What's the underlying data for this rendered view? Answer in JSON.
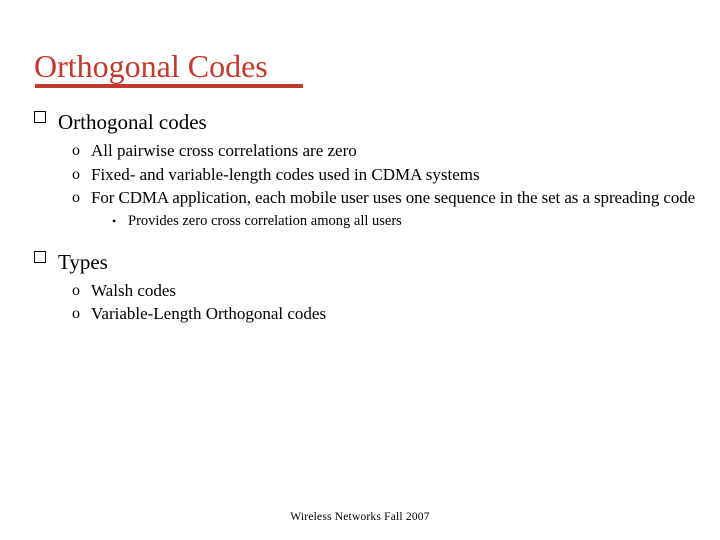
{
  "slide": {
    "title": "Orthogonal Codes",
    "title_color": "#C13A2E",
    "background_color": "#FFFFFF",
    "text_color": "#000000",
    "footer": "Wireless Networks Fall 2007",
    "bullet_markers": {
      "level1": "box-bullet",
      "level2": "o",
      "level3": "•"
    },
    "sections": [
      {
        "heading": "Orthogonal codes",
        "items": [
          {
            "level": 2,
            "text": "All pairwise cross correlations are zero"
          },
          {
            "level": 2,
            "text": "Fixed- and variable-length codes used in CDMA systems"
          },
          {
            "level": 2,
            "text": "For CDMA application, each mobile user uses one sequence in the set as a spreading code"
          },
          {
            "level": 3,
            "text": "Provides zero cross correlation among all users"
          }
        ]
      },
      {
        "heading": "Types",
        "items": [
          {
            "level": 2,
            "text": "Walsh codes"
          },
          {
            "level": 2,
            "text": "Variable-Length Orthogonal codes"
          }
        ]
      }
    ]
  }
}
